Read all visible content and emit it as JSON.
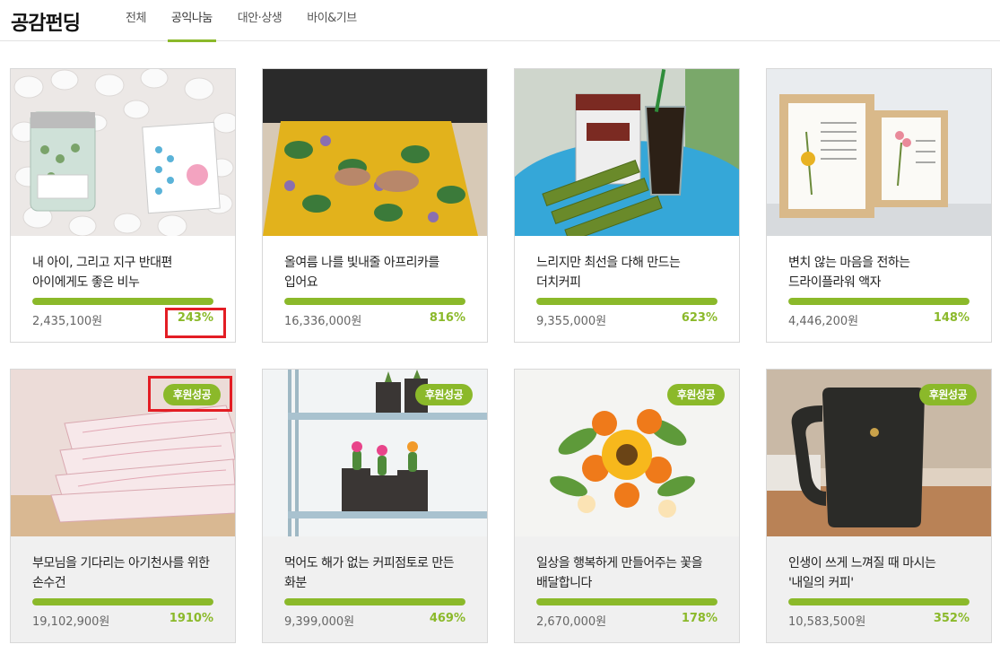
{
  "header": {
    "brand": "공감펀딩",
    "tabs": [
      {
        "label": "전체",
        "active": false
      },
      {
        "label": "공익나눔",
        "active": true
      },
      {
        "label": "대안·상생",
        "active": false
      },
      {
        "label": "바이&기브",
        "active": false
      }
    ]
  },
  "colors": {
    "accent": "#8bb92a",
    "highlight": "#e31d24"
  },
  "cards": [
    {
      "title": "내 아이, 그리고 지구 반대편 아이에게도 좋은 비누",
      "amount": "2,435,100원",
      "percent": "243%",
      "progress": 1.0,
      "image": "soap-jar-image"
    },
    {
      "title": "올여름 나를 빛내줄 아프리카를 입어요",
      "amount": "16,336,000원",
      "percent": "816%",
      "progress": 1.0,
      "image": "african-skirt-image"
    },
    {
      "title": "느리지만 최선을 다해 만드는 더치커피",
      "amount": "9,355,000원",
      "percent": "623%",
      "progress": 1.0,
      "image": "dutch-coffee-image"
    },
    {
      "title": "변치 않는 마음을 전하는 드라이플라워 액자",
      "amount": "4,446,200원",
      "percent": "148%",
      "progress": 1.0,
      "image": "dried-flower-frame-image"
    },
    {
      "title": "부모님을 기다리는 아기천사를 위한 손수건",
      "amount": "19,102,900원",
      "percent": "1910%",
      "progress": 1.0,
      "badge": "후원성공",
      "image": "handkerchief-image"
    },
    {
      "title": "먹어도 해가 없는 커피점토로 만든 화분",
      "amount": "9,399,000원",
      "percent": "469%",
      "progress": 1.0,
      "badge": "후원성공",
      "image": "cactus-pots-image"
    },
    {
      "title": "일상을 행복하게 만들어주는 꽃을 배달합니다",
      "amount": "2,670,000원",
      "percent": "178%",
      "progress": 1.0,
      "badge": "후원성공",
      "image": "sunflower-bouquet-image"
    },
    {
      "title": "인생이 쓰게 느껴질 때 마시는 '내일의 커피'",
      "amount": "10,583,500원",
      "percent": "352%",
      "progress": 1.0,
      "badge": "후원성공",
      "image": "black-mug-image"
    }
  ]
}
